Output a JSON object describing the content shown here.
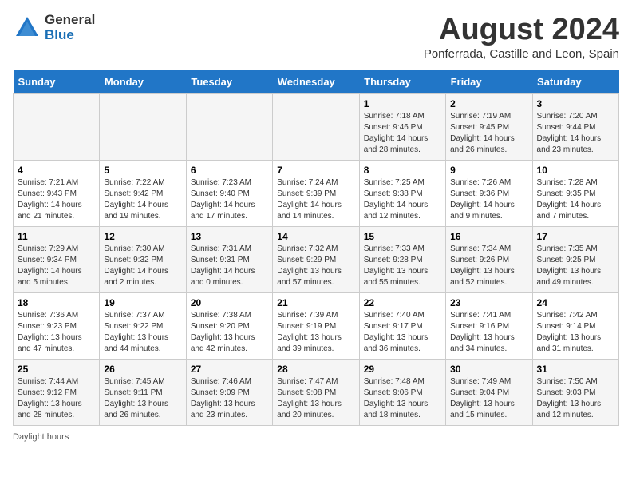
{
  "logo": {
    "general": "General",
    "blue": "Blue"
  },
  "title": {
    "month": "August 2024",
    "location": "Ponferrada, Castille and Leon, Spain"
  },
  "days_header": [
    "Sunday",
    "Monday",
    "Tuesday",
    "Wednesday",
    "Thursday",
    "Friday",
    "Saturday"
  ],
  "weeks": [
    [
      {
        "day": "",
        "info": ""
      },
      {
        "day": "",
        "info": ""
      },
      {
        "day": "",
        "info": ""
      },
      {
        "day": "",
        "info": ""
      },
      {
        "day": "1",
        "info": "Sunrise: 7:18 AM\nSunset: 9:46 PM\nDaylight: 14 hours\nand 28 minutes."
      },
      {
        "day": "2",
        "info": "Sunrise: 7:19 AM\nSunset: 9:45 PM\nDaylight: 14 hours\nand 26 minutes."
      },
      {
        "day": "3",
        "info": "Sunrise: 7:20 AM\nSunset: 9:44 PM\nDaylight: 14 hours\nand 23 minutes."
      }
    ],
    [
      {
        "day": "4",
        "info": "Sunrise: 7:21 AM\nSunset: 9:43 PM\nDaylight: 14 hours\nand 21 minutes."
      },
      {
        "day": "5",
        "info": "Sunrise: 7:22 AM\nSunset: 9:42 PM\nDaylight: 14 hours\nand 19 minutes."
      },
      {
        "day": "6",
        "info": "Sunrise: 7:23 AM\nSunset: 9:40 PM\nDaylight: 14 hours\nand 17 minutes."
      },
      {
        "day": "7",
        "info": "Sunrise: 7:24 AM\nSunset: 9:39 PM\nDaylight: 14 hours\nand 14 minutes."
      },
      {
        "day": "8",
        "info": "Sunrise: 7:25 AM\nSunset: 9:38 PM\nDaylight: 14 hours\nand 12 minutes."
      },
      {
        "day": "9",
        "info": "Sunrise: 7:26 AM\nSunset: 9:36 PM\nDaylight: 14 hours\nand 9 minutes."
      },
      {
        "day": "10",
        "info": "Sunrise: 7:28 AM\nSunset: 9:35 PM\nDaylight: 14 hours\nand 7 minutes."
      }
    ],
    [
      {
        "day": "11",
        "info": "Sunrise: 7:29 AM\nSunset: 9:34 PM\nDaylight: 14 hours\nand 5 minutes."
      },
      {
        "day": "12",
        "info": "Sunrise: 7:30 AM\nSunset: 9:32 PM\nDaylight: 14 hours\nand 2 minutes."
      },
      {
        "day": "13",
        "info": "Sunrise: 7:31 AM\nSunset: 9:31 PM\nDaylight: 14 hours\nand 0 minutes."
      },
      {
        "day": "14",
        "info": "Sunrise: 7:32 AM\nSunset: 9:29 PM\nDaylight: 13 hours\nand 57 minutes."
      },
      {
        "day": "15",
        "info": "Sunrise: 7:33 AM\nSunset: 9:28 PM\nDaylight: 13 hours\nand 55 minutes."
      },
      {
        "day": "16",
        "info": "Sunrise: 7:34 AM\nSunset: 9:26 PM\nDaylight: 13 hours\nand 52 minutes."
      },
      {
        "day": "17",
        "info": "Sunrise: 7:35 AM\nSunset: 9:25 PM\nDaylight: 13 hours\nand 49 minutes."
      }
    ],
    [
      {
        "day": "18",
        "info": "Sunrise: 7:36 AM\nSunset: 9:23 PM\nDaylight: 13 hours\nand 47 minutes."
      },
      {
        "day": "19",
        "info": "Sunrise: 7:37 AM\nSunset: 9:22 PM\nDaylight: 13 hours\nand 44 minutes."
      },
      {
        "day": "20",
        "info": "Sunrise: 7:38 AM\nSunset: 9:20 PM\nDaylight: 13 hours\nand 42 minutes."
      },
      {
        "day": "21",
        "info": "Sunrise: 7:39 AM\nSunset: 9:19 PM\nDaylight: 13 hours\nand 39 minutes."
      },
      {
        "day": "22",
        "info": "Sunrise: 7:40 AM\nSunset: 9:17 PM\nDaylight: 13 hours\nand 36 minutes."
      },
      {
        "day": "23",
        "info": "Sunrise: 7:41 AM\nSunset: 9:16 PM\nDaylight: 13 hours\nand 34 minutes."
      },
      {
        "day": "24",
        "info": "Sunrise: 7:42 AM\nSunset: 9:14 PM\nDaylight: 13 hours\nand 31 minutes."
      }
    ],
    [
      {
        "day": "25",
        "info": "Sunrise: 7:44 AM\nSunset: 9:12 PM\nDaylight: 13 hours\nand 28 minutes."
      },
      {
        "day": "26",
        "info": "Sunrise: 7:45 AM\nSunset: 9:11 PM\nDaylight: 13 hours\nand 26 minutes."
      },
      {
        "day": "27",
        "info": "Sunrise: 7:46 AM\nSunset: 9:09 PM\nDaylight: 13 hours\nand 23 minutes."
      },
      {
        "day": "28",
        "info": "Sunrise: 7:47 AM\nSunset: 9:08 PM\nDaylight: 13 hours\nand 20 minutes."
      },
      {
        "day": "29",
        "info": "Sunrise: 7:48 AM\nSunset: 9:06 PM\nDaylight: 13 hours\nand 18 minutes."
      },
      {
        "day": "30",
        "info": "Sunrise: 7:49 AM\nSunset: 9:04 PM\nDaylight: 13 hours\nand 15 minutes."
      },
      {
        "day": "31",
        "info": "Sunrise: 7:50 AM\nSunset: 9:03 PM\nDaylight: 13 hours\nand 12 minutes."
      }
    ]
  ],
  "footer": {
    "daylight_label": "Daylight hours"
  }
}
